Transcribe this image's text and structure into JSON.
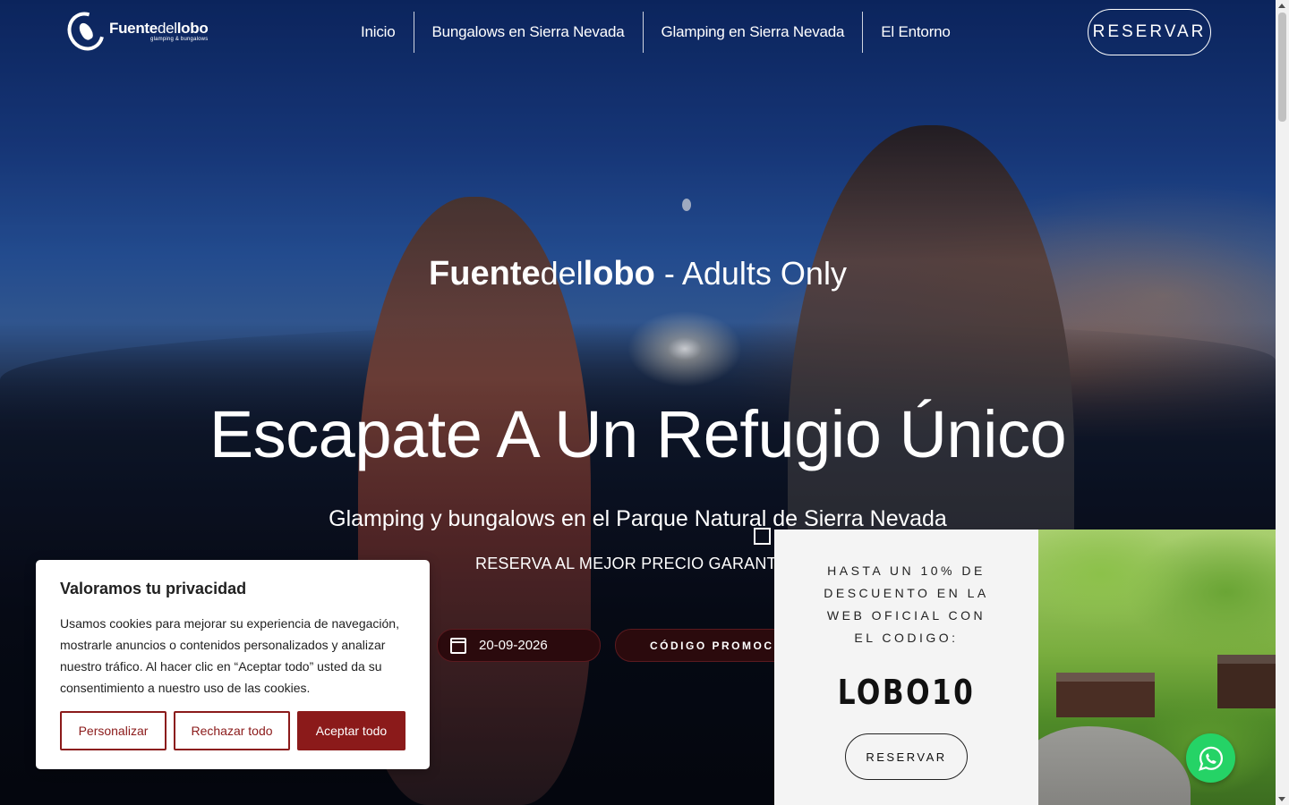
{
  "header": {
    "logo": {
      "part1": "Fuente",
      "part2": "del",
      "part3": "lobo",
      "tagline": "glamping & bungalows"
    },
    "nav": [
      {
        "label": "Inicio"
      },
      {
        "label": "Bungalows en Sierra Nevada"
      },
      {
        "label": "Glamping en Sierra Nevada"
      },
      {
        "label": "El Entorno"
      }
    ],
    "reservar_label": "RESERVAR"
  },
  "hero": {
    "brand": {
      "part1": "Fuente",
      "part2": "del",
      "part3": "lobo",
      "suffix": " - Adults Only"
    },
    "headline": "Escapate A Un Refugio Único",
    "subline": "Glamping y bungalows en el Parque Natural de Sierra Nevada",
    "guarantee": "RESERVA AL MEJOR PRECIO GARANTIZA"
  },
  "booking": {
    "date_value": "20-09-2026",
    "promo_label": "CÓDIGO PROMOC"
  },
  "promo_popup": {
    "text": "HASTA UN 10% DE DESCUENTO EN LA WEB OFICIAL CON EL CODIGO:",
    "code": "LOBO10",
    "button_label": "RESERVAR"
  },
  "cookie_banner": {
    "title": "Valoramos tu privacidad",
    "body": "Usamos cookies para mejorar su experiencia de navegación, mostrarle anuncios o contenidos personalizados y analizar nuestro tráfico. Al hacer clic en “Aceptar todo” usted da su consentimiento a nuestro uso de las cookies.",
    "customize_label": "Personalizar",
    "reject_label": "Rechazar todo",
    "accept_label": "Aceptar todo"
  },
  "colors": {
    "accent": "#8b1a1a",
    "whatsapp": "#25d366"
  },
  "icons": {
    "calendar": "calendar-icon",
    "whatsapp": "whatsapp-icon",
    "close": "close-icon",
    "logo": "wolf-logo-icon"
  }
}
